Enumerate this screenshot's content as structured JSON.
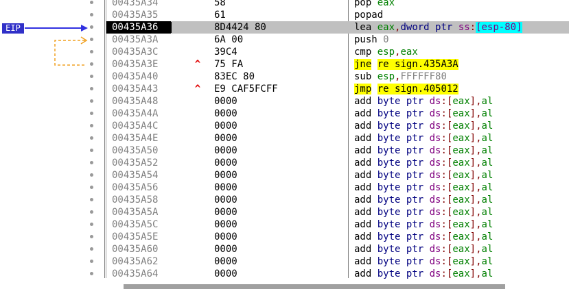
{
  "eip": {
    "label": "EIP"
  },
  "rows": [
    {
      "addr": "00435A34",
      "hex": "58",
      "jmp": "",
      "dis": [
        {
          "t": "pop",
          "c": "k-mn"
        },
        {
          "t": " "
        },
        {
          "t": "eax",
          "c": "k-reg"
        }
      ]
    },
    {
      "addr": "00435A35",
      "hex": "61",
      "jmp": "",
      "dis": [
        {
          "t": "popad",
          "c": "k-mn"
        }
      ]
    },
    {
      "addr": "00435A36",
      "hex": "8D4424 80",
      "jmp": "",
      "sel": true,
      "dis": [
        {
          "t": "lea",
          "c": "k-mn"
        },
        {
          "t": " "
        },
        {
          "t": "eax",
          "c": "k-reg"
        },
        {
          "t": ",",
          "c": "k-pun"
        },
        {
          "t": "dword ptr",
          "c": "k-kw"
        },
        {
          "t": " "
        },
        {
          "t": "ss",
          "c": "k-seg"
        },
        {
          "t": ":",
          "c": "k-pun"
        },
        {
          "t": "[",
          "c": "hl-seg"
        },
        {
          "t": "esp-80",
          "c": "hl-seg"
        },
        {
          "t": "]",
          "c": "hl-seg"
        }
      ]
    },
    {
      "addr": "00435A3A",
      "hex": "6A 00",
      "jmp": "",
      "dis": [
        {
          "t": "push",
          "c": "k-mn"
        },
        {
          "t": " "
        },
        {
          "t": "0",
          "c": "k-num"
        }
      ]
    },
    {
      "addr": "00435A3C",
      "hex": "39C4",
      "jmp": "",
      "dis": [
        {
          "t": "cmp",
          "c": "k-mn"
        },
        {
          "t": " "
        },
        {
          "t": "esp",
          "c": "k-reg"
        },
        {
          "t": ",",
          "c": "k-pun"
        },
        {
          "t": "eax",
          "c": "k-reg"
        }
      ]
    },
    {
      "addr": "00435A3E",
      "hex": "75 FA",
      "jmp": "^",
      "dis": [
        {
          "t": "jne",
          "c": "hl-jmp"
        },
        {
          "t": " "
        },
        {
          "t": "re sign.435A3A",
          "c": "hl-tgt"
        }
      ]
    },
    {
      "addr": "00435A40",
      "hex": "83EC 80",
      "jmp": "",
      "dis": [
        {
          "t": "sub",
          "c": "k-mn"
        },
        {
          "t": " "
        },
        {
          "t": "esp",
          "c": "k-reg"
        },
        {
          "t": ",",
          "c": "k-pun"
        },
        {
          "t": "FFFFFF80",
          "c": "k-num"
        }
      ]
    },
    {
      "addr": "00435A43",
      "hex": "E9 CAF5FCFF",
      "jmp": "^",
      "dis": [
        {
          "t": "jmp",
          "c": "hl-jmp"
        },
        {
          "t": " "
        },
        {
          "t": "re sign.405012",
          "c": "hl-tgt"
        }
      ]
    },
    {
      "addr": "00435A48",
      "hex": "0000",
      "jmp": "",
      "dis": "add"
    },
    {
      "addr": "00435A4A",
      "hex": "0000",
      "jmp": "",
      "dis": "add"
    },
    {
      "addr": "00435A4C",
      "hex": "0000",
      "jmp": "",
      "dis": "add"
    },
    {
      "addr": "00435A4E",
      "hex": "0000",
      "jmp": "",
      "dis": "add"
    },
    {
      "addr": "00435A50",
      "hex": "0000",
      "jmp": "",
      "dis": "add"
    },
    {
      "addr": "00435A52",
      "hex": "0000",
      "jmp": "",
      "dis": "add"
    },
    {
      "addr": "00435A54",
      "hex": "0000",
      "jmp": "",
      "dis": "add"
    },
    {
      "addr": "00435A56",
      "hex": "0000",
      "jmp": "",
      "dis": "add"
    },
    {
      "addr": "00435A58",
      "hex": "0000",
      "jmp": "",
      "dis": "add"
    },
    {
      "addr": "00435A5A",
      "hex": "0000",
      "jmp": "",
      "dis": "add"
    },
    {
      "addr": "00435A5C",
      "hex": "0000",
      "jmp": "",
      "dis": "add"
    },
    {
      "addr": "00435A5E",
      "hex": "0000",
      "jmp": "",
      "dis": "add"
    },
    {
      "addr": "00435A60",
      "hex": "0000",
      "jmp": "",
      "dis": "add"
    },
    {
      "addr": "00435A62",
      "hex": "0000",
      "jmp": "",
      "dis": "add"
    },
    {
      "addr": "00435A64",
      "hex": "0000",
      "jmp": "",
      "dis": "add"
    }
  ],
  "add_instr": [
    {
      "t": "add",
      "c": "k-mn"
    },
    {
      "t": " "
    },
    {
      "t": "byte ptr",
      "c": "k-kw"
    },
    {
      "t": " "
    },
    {
      "t": "ds",
      "c": "k-seg"
    },
    {
      "t": ":",
      "c": "k-pun"
    },
    {
      "t": "[",
      "c": "k-pun"
    },
    {
      "t": "eax",
      "c": "k-reg"
    },
    {
      "t": "]",
      "c": "k-pun"
    },
    {
      "t": ",",
      "c": "k-pun"
    },
    {
      "t": "al",
      "c": "k-reg"
    }
  ],
  "colors": {
    "eip_bg": "#3030c8",
    "selection": "#c0c0c0",
    "jump_highlight": "#ffff00",
    "segment_highlight": "#00ffff",
    "jump_arrow": "#f0a020"
  }
}
